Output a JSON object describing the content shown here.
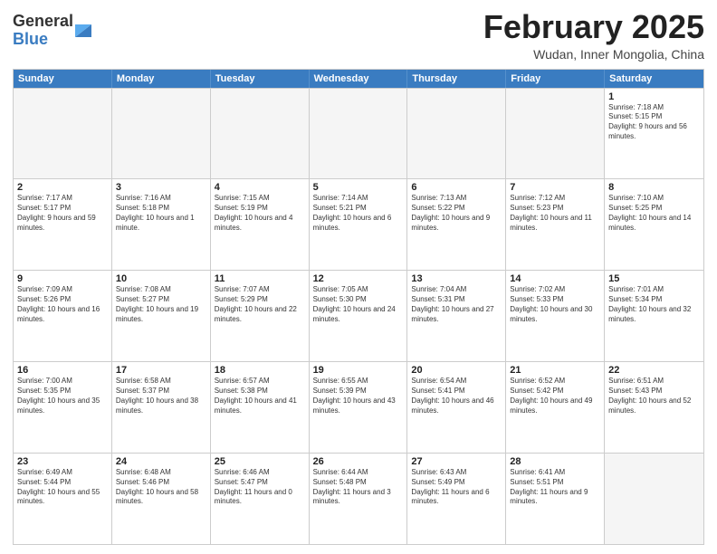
{
  "header": {
    "logo_general": "General",
    "logo_blue": "Blue",
    "month_title": "February 2025",
    "location": "Wudan, Inner Mongolia, China"
  },
  "weekdays": [
    "Sunday",
    "Monday",
    "Tuesday",
    "Wednesday",
    "Thursday",
    "Friday",
    "Saturday"
  ],
  "weeks": [
    [
      {
        "day": "",
        "empty": true
      },
      {
        "day": "",
        "empty": true
      },
      {
        "day": "",
        "empty": true
      },
      {
        "day": "",
        "empty": true
      },
      {
        "day": "",
        "empty": true
      },
      {
        "day": "",
        "empty": true
      },
      {
        "day": "1",
        "sunrise": "7:18 AM",
        "sunset": "5:15 PM",
        "daylight": "9 hours and 56 minutes."
      }
    ],
    [
      {
        "day": "2",
        "sunrise": "7:17 AM",
        "sunset": "5:17 PM",
        "daylight": "9 hours and 59 minutes."
      },
      {
        "day": "3",
        "sunrise": "7:16 AM",
        "sunset": "5:18 PM",
        "daylight": "10 hours and 1 minute."
      },
      {
        "day": "4",
        "sunrise": "7:15 AM",
        "sunset": "5:19 PM",
        "daylight": "10 hours and 4 minutes."
      },
      {
        "day": "5",
        "sunrise": "7:14 AM",
        "sunset": "5:21 PM",
        "daylight": "10 hours and 6 minutes."
      },
      {
        "day": "6",
        "sunrise": "7:13 AM",
        "sunset": "5:22 PM",
        "daylight": "10 hours and 9 minutes."
      },
      {
        "day": "7",
        "sunrise": "7:12 AM",
        "sunset": "5:23 PM",
        "daylight": "10 hours and 11 minutes."
      },
      {
        "day": "8",
        "sunrise": "7:10 AM",
        "sunset": "5:25 PM",
        "daylight": "10 hours and 14 minutes."
      }
    ],
    [
      {
        "day": "9",
        "sunrise": "7:09 AM",
        "sunset": "5:26 PM",
        "daylight": "10 hours and 16 minutes."
      },
      {
        "day": "10",
        "sunrise": "7:08 AM",
        "sunset": "5:27 PM",
        "daylight": "10 hours and 19 minutes."
      },
      {
        "day": "11",
        "sunrise": "7:07 AM",
        "sunset": "5:29 PM",
        "daylight": "10 hours and 22 minutes."
      },
      {
        "day": "12",
        "sunrise": "7:05 AM",
        "sunset": "5:30 PM",
        "daylight": "10 hours and 24 minutes."
      },
      {
        "day": "13",
        "sunrise": "7:04 AM",
        "sunset": "5:31 PM",
        "daylight": "10 hours and 27 minutes."
      },
      {
        "day": "14",
        "sunrise": "7:02 AM",
        "sunset": "5:33 PM",
        "daylight": "10 hours and 30 minutes."
      },
      {
        "day": "15",
        "sunrise": "7:01 AM",
        "sunset": "5:34 PM",
        "daylight": "10 hours and 32 minutes."
      }
    ],
    [
      {
        "day": "16",
        "sunrise": "7:00 AM",
        "sunset": "5:35 PM",
        "daylight": "10 hours and 35 minutes."
      },
      {
        "day": "17",
        "sunrise": "6:58 AM",
        "sunset": "5:37 PM",
        "daylight": "10 hours and 38 minutes."
      },
      {
        "day": "18",
        "sunrise": "6:57 AM",
        "sunset": "5:38 PM",
        "daylight": "10 hours and 41 minutes."
      },
      {
        "day": "19",
        "sunrise": "6:55 AM",
        "sunset": "5:39 PM",
        "daylight": "10 hours and 43 minutes."
      },
      {
        "day": "20",
        "sunrise": "6:54 AM",
        "sunset": "5:41 PM",
        "daylight": "10 hours and 46 minutes."
      },
      {
        "day": "21",
        "sunrise": "6:52 AM",
        "sunset": "5:42 PM",
        "daylight": "10 hours and 49 minutes."
      },
      {
        "day": "22",
        "sunrise": "6:51 AM",
        "sunset": "5:43 PM",
        "daylight": "10 hours and 52 minutes."
      }
    ],
    [
      {
        "day": "23",
        "sunrise": "6:49 AM",
        "sunset": "5:44 PM",
        "daylight": "10 hours and 55 minutes."
      },
      {
        "day": "24",
        "sunrise": "6:48 AM",
        "sunset": "5:46 PM",
        "daylight": "10 hours and 58 minutes."
      },
      {
        "day": "25",
        "sunrise": "6:46 AM",
        "sunset": "5:47 PM",
        "daylight": "11 hours and 0 minutes."
      },
      {
        "day": "26",
        "sunrise": "6:44 AM",
        "sunset": "5:48 PM",
        "daylight": "11 hours and 3 minutes."
      },
      {
        "day": "27",
        "sunrise": "6:43 AM",
        "sunset": "5:49 PM",
        "daylight": "11 hours and 6 minutes."
      },
      {
        "day": "28",
        "sunrise": "6:41 AM",
        "sunset": "5:51 PM",
        "daylight": "11 hours and 9 minutes."
      },
      {
        "day": "",
        "empty": true
      }
    ]
  ]
}
